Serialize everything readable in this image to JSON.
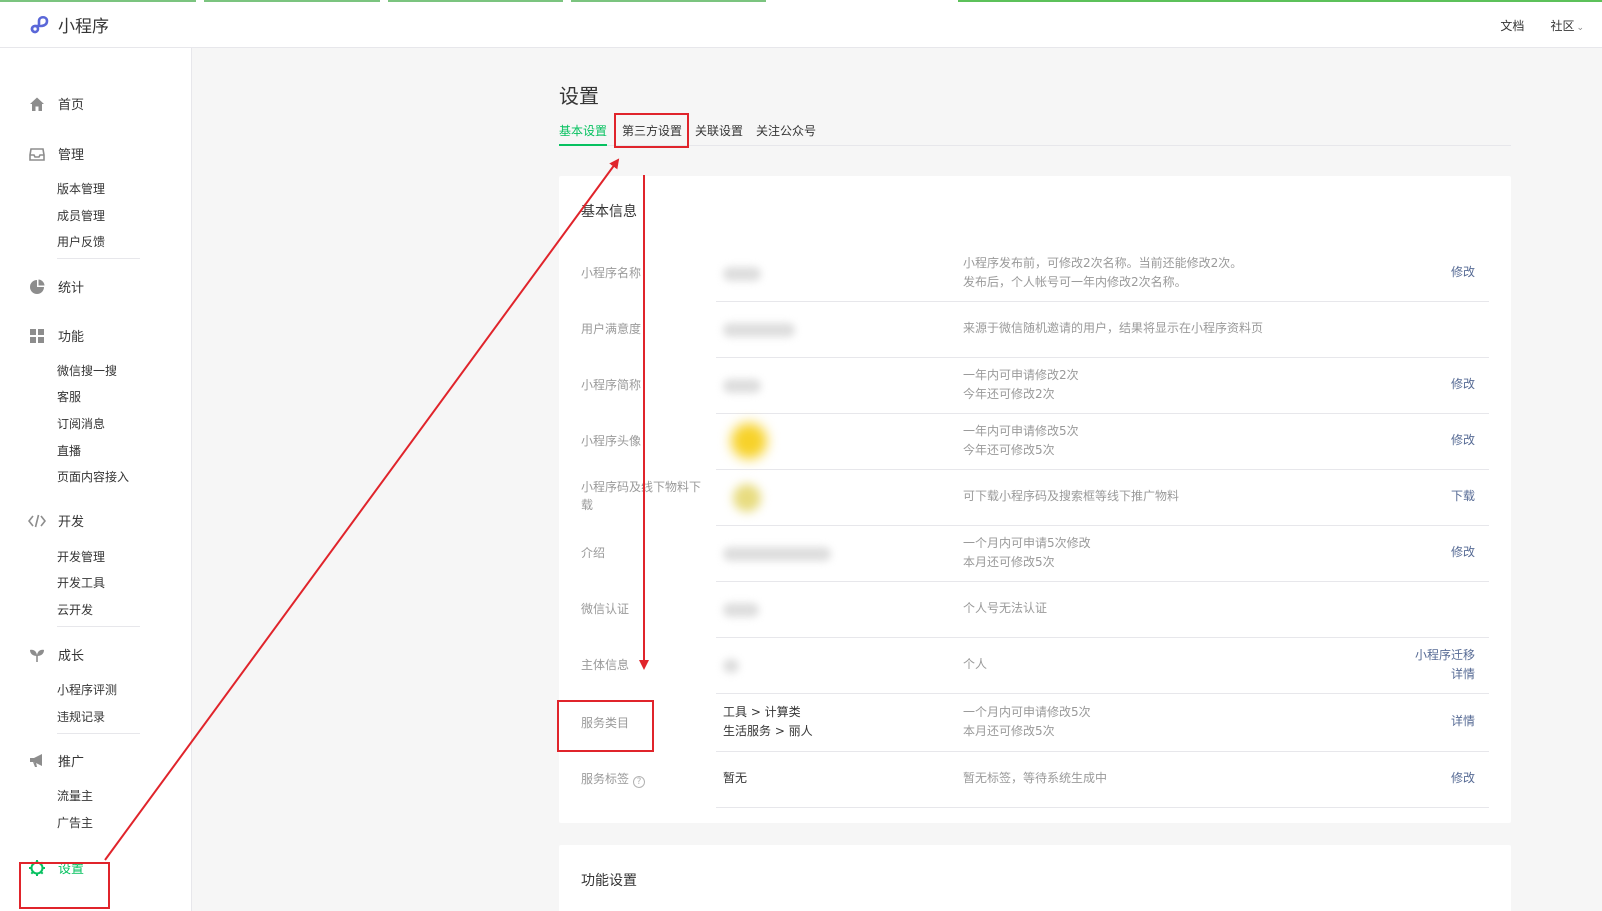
{
  "header": {
    "logo_text": "小程序",
    "links": [
      "文档",
      "社区"
    ]
  },
  "sidebar": {
    "groups": [
      {
        "label": "首页",
        "icon": "home-icon",
        "items": []
      },
      {
        "label": "管理",
        "icon": "inbox-icon",
        "items": [
          "版本管理",
          "成员管理",
          "用户反馈"
        ]
      },
      {
        "label": "统计",
        "icon": "pie-chart-icon",
        "items": []
      },
      {
        "label": "功能",
        "icon": "grid-icon",
        "items": [
          "微信搜一搜",
          "客服",
          "订阅消息",
          "直播",
          "页面内容接入"
        ]
      },
      {
        "label": "开发",
        "icon": "code-icon",
        "items": [
          "开发管理",
          "开发工具",
          "云开发"
        ]
      },
      {
        "label": "成长",
        "icon": "sprout-icon",
        "items": [
          "小程序评测",
          "违规记录"
        ]
      },
      {
        "label": "推广",
        "icon": "megaphone-icon",
        "items": [
          "流量主",
          "广告主"
        ]
      },
      {
        "label": "设置",
        "icon": "gear-icon",
        "items": [],
        "active": true
      }
    ]
  },
  "page": {
    "title": "设置",
    "tabs": [
      "基本设置",
      "第三方设置",
      "关联设置",
      "关注公众号"
    ],
    "active_tab": "基本设置"
  },
  "basic_info": {
    "title": "基本信息",
    "rows": [
      {
        "label": "小程序名称",
        "value": "",
        "desc": [
          "小程序发布前，可修改2次名称。当前还能修改2次。",
          "发布后，个人帐号可一年内修改2次名称。"
        ],
        "actions": [
          "修改"
        ]
      },
      {
        "label": "用户满意度",
        "value": "",
        "desc": [
          "来源于微信随机邀请的用户，结果将显示在小程序资料页"
        ],
        "actions": []
      },
      {
        "label": "小程序简称",
        "value": "",
        "desc": [
          "一年内可申请修改2次",
          "今年还可修改2次"
        ],
        "actions": [
          "修改"
        ]
      },
      {
        "label": "小程序头像",
        "value": "",
        "desc": [
          "一年内可申请修改5次",
          "今年还可修改5次"
        ],
        "actions": [
          "修改"
        ]
      },
      {
        "label": "小程序码及线下物料下载",
        "value": "",
        "desc": [
          "可下载小程序码及搜索框等线下推广物料"
        ],
        "actions": [
          "下载"
        ]
      },
      {
        "label": "介绍",
        "value": "",
        "desc": [
          "一个月内可申请5次修改",
          "本月还可修改5次"
        ],
        "actions": [
          "修改"
        ]
      },
      {
        "label": "微信认证",
        "value": "",
        "desc": [
          "个人号无法认证"
        ],
        "actions": []
      },
      {
        "label": "主体信息",
        "value": "",
        "desc": [
          "个人"
        ],
        "actions": [
          "小程序迁移",
          "详情"
        ]
      },
      {
        "label": "服务类目",
        "value_lines": [
          "工具 > 计算类",
          "生活服务 > 丽人"
        ],
        "desc": [
          "一个月内可申请修改5次",
          "本月还可修改5次"
        ],
        "actions": [
          "详情"
        ]
      },
      {
        "label": "服务标签",
        "value": "暂无",
        "desc": [
          "暂无标签，等待系统生成中"
        ],
        "actions": [
          "修改"
        ]
      }
    ]
  },
  "feature_settings": {
    "title": "功能设置"
  },
  "colors": {
    "accent": "#07c160",
    "link": "#576b95",
    "annotation": "#e0242b"
  }
}
